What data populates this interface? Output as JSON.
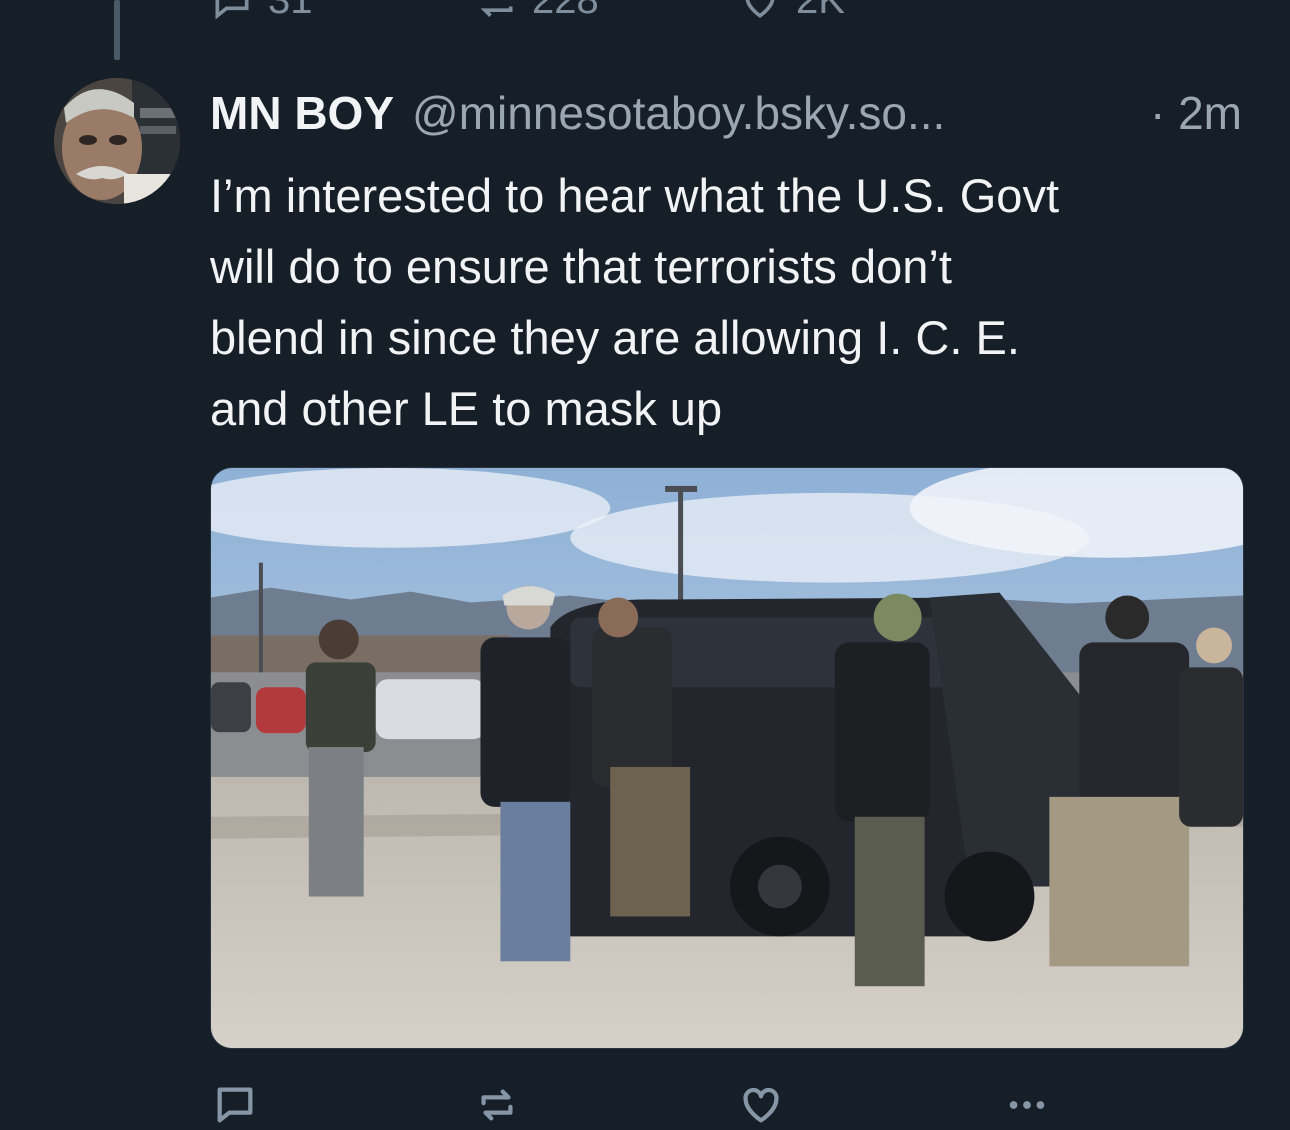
{
  "previous_post": {
    "reply_count": "31",
    "repost_count": "228",
    "like_count": "2K"
  },
  "post": {
    "display_name": "MN BOY",
    "handle": "@minnesotaboy.bsky.so...",
    "timestamp": "· 2m",
    "text": "I’m interested to hear what the U.S. Govt\nwill do to ensure that terrorists don’t\nblend in since they are allowing I. C. E.\nand other LE to mask up"
  },
  "icons": {
    "reply": "speech-bubble-icon",
    "repost": "repost-arrows-icon",
    "like": "heart-icon",
    "more": "ellipsis-icon"
  },
  "colors": {
    "background": "#161e27",
    "text": "#f1f3f5",
    "muted": "#9aa7b3",
    "icon": "#8696a6"
  }
}
